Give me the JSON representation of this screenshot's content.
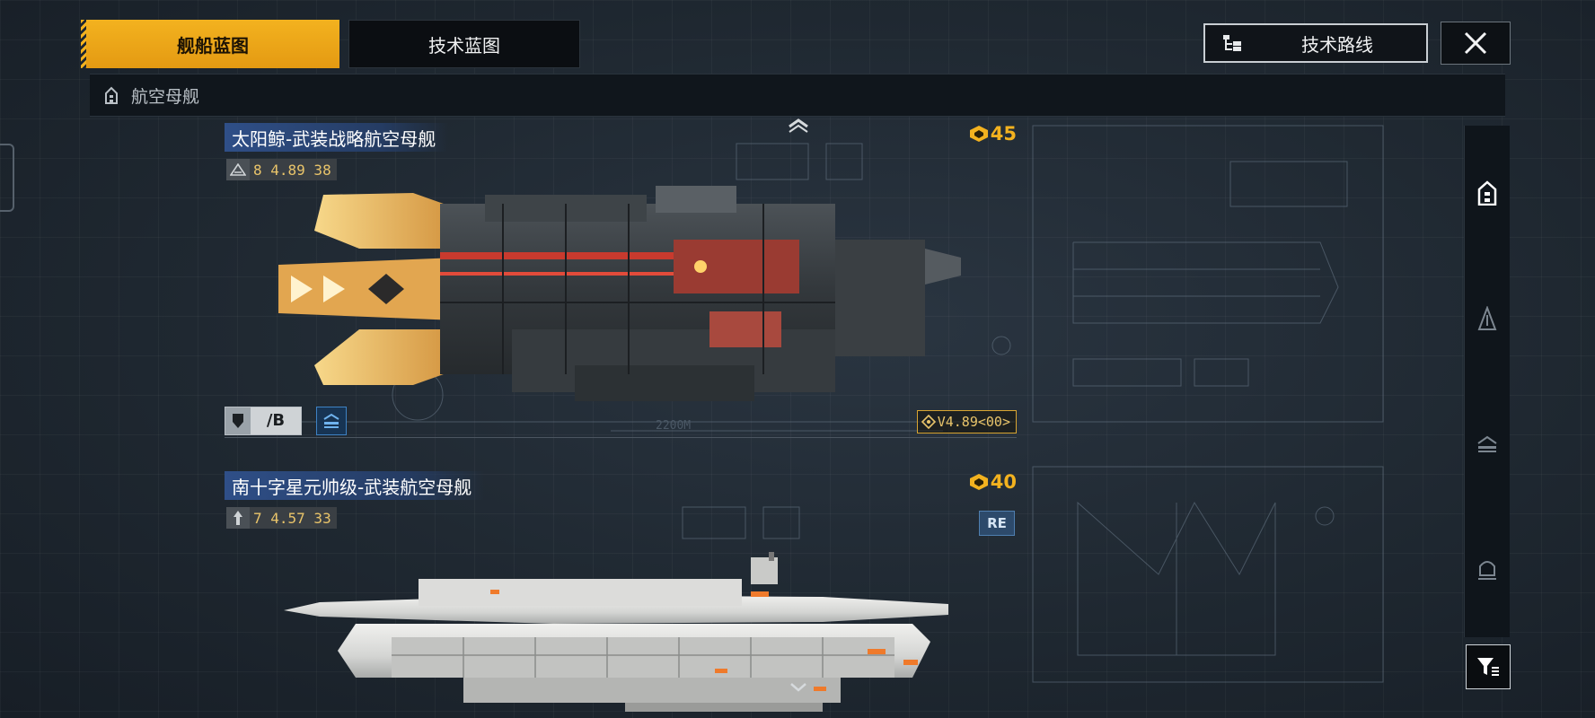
{
  "tabs": [
    {
      "label": "舰船蓝图",
      "active": true
    },
    {
      "label": "技术蓝图",
      "active": false
    }
  ],
  "header": {
    "route_label": "技术路线",
    "close_icon": "close-icon"
  },
  "category": {
    "label": "航空母舰",
    "icon": "carrier-icon"
  },
  "ships": [
    {
      "name": "太阳鲸-武装战略航空母舰",
      "stats": "8 4.89 38",
      "cost": "45",
      "tier": "/B",
      "version": "V4.89<00>",
      "blueprint_length": "2200M"
    },
    {
      "name": "南十字星元帅级-武装航空母舰",
      "stats": "7 4.57 33",
      "cost": "40",
      "badge": "RE"
    }
  ],
  "sidebar": {
    "items": [
      "carrier-icon",
      "destroyer-icon",
      "frigate-icon",
      "cruiser-icon"
    ],
    "filter_icon": "filter-icon"
  },
  "colors": {
    "accent": "#f3b21f",
    "background": "#1c2530",
    "title_bar": "#2f4f88"
  }
}
